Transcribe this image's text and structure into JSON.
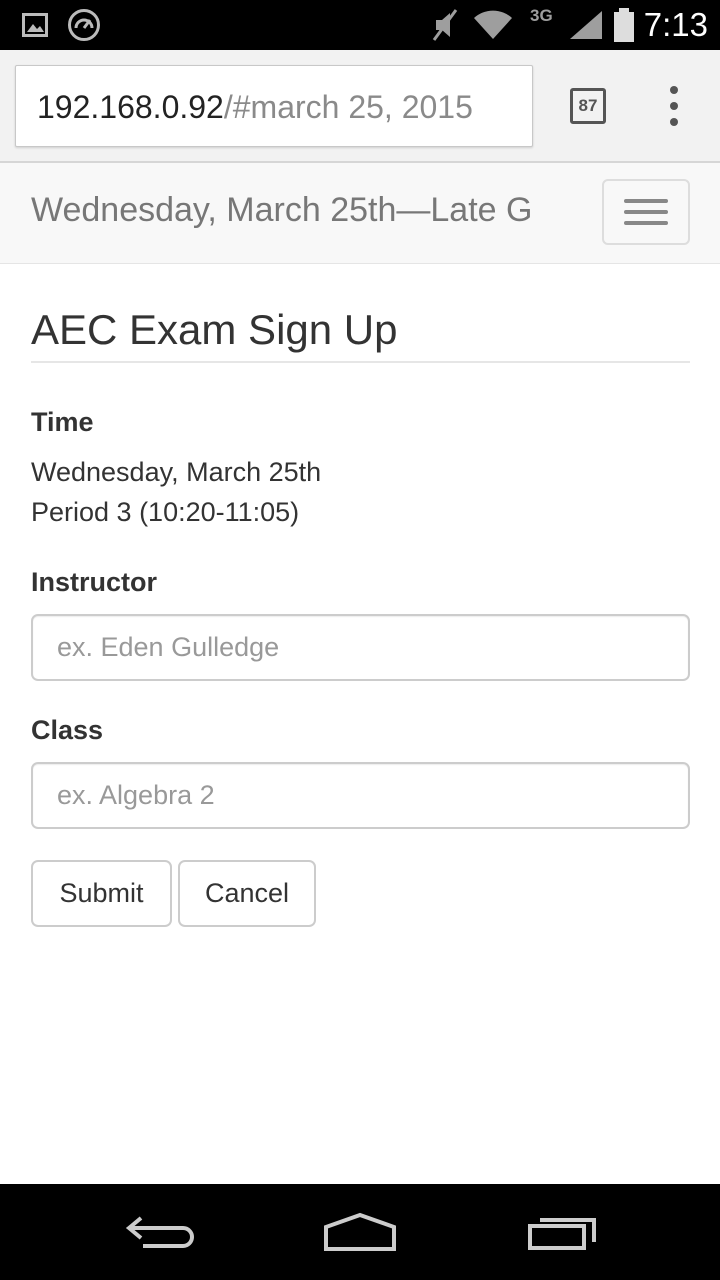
{
  "status_bar": {
    "time": "7:13",
    "network": "3G",
    "icons": [
      "image-notification-icon",
      "speedometer-notification-icon",
      "mute-icon",
      "wifi-icon",
      "signal-icon",
      "battery-icon"
    ]
  },
  "browser": {
    "url_host": "192.168.0.92",
    "url_rest": "/#march 25, 2015",
    "tab_count": "87",
    "menu_icon": "overflow-menu-icon"
  },
  "navbar": {
    "brand": "Wednesday, March 25th—Late G",
    "toggle_icon": "hamburger-icon"
  },
  "form": {
    "title": "AEC Exam Sign Up",
    "time_label": "Time",
    "time_lines": [
      "Wednesday, March 25th",
      "Period 3 (10:20-11:05)"
    ],
    "instructor_label": "Instructor",
    "instructor_placeholder": "ex. Eden Gulledge",
    "instructor_value": "",
    "class_label": "Class",
    "class_placeholder": "ex. Algebra 2",
    "class_value": "",
    "submit_label": "Submit",
    "cancel_label": "Cancel"
  },
  "system_nav": {
    "icons": [
      "back-icon",
      "home-icon",
      "recents-icon"
    ]
  },
  "colors": {
    "navbar_bg": "#f8f8f8",
    "brand_text": "#777777",
    "body_text": "#333333",
    "placeholder": "#999999",
    "border": "#cccccc"
  }
}
